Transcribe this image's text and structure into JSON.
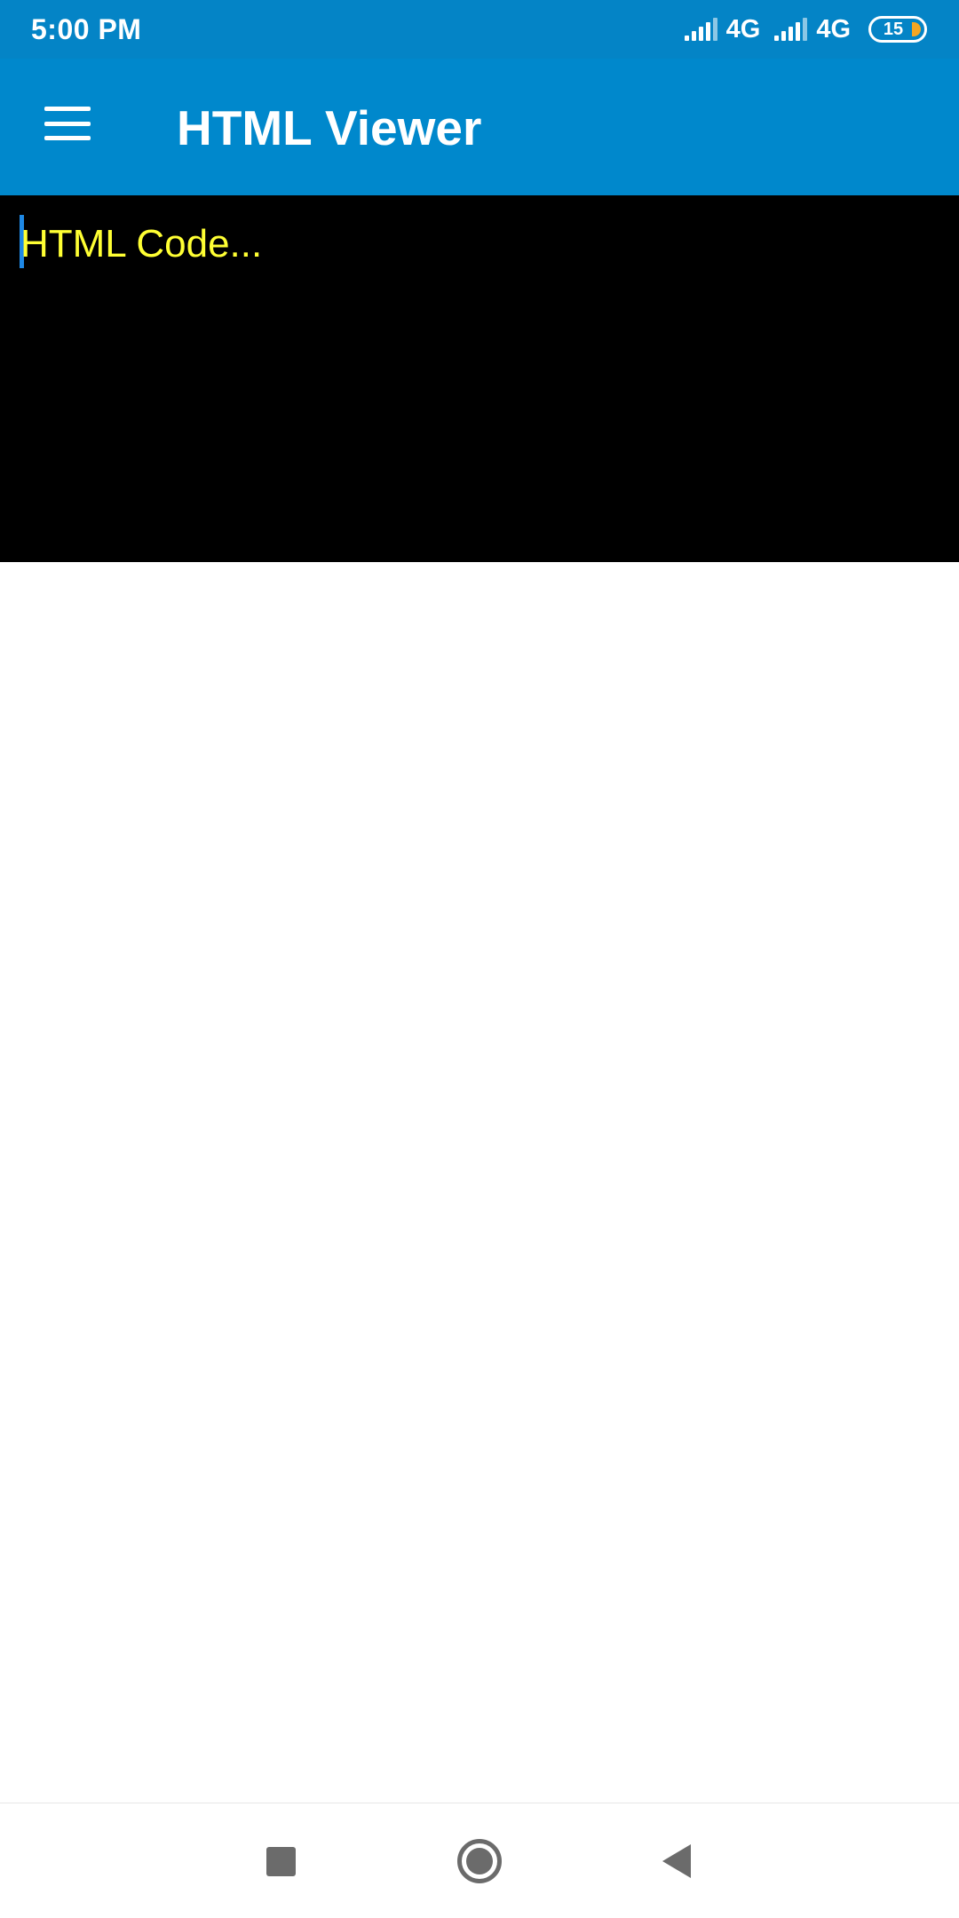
{
  "status_bar": {
    "time": "5:00 PM",
    "network_1": "4G",
    "network_2": "4G",
    "battery_level": "15",
    "icons": [
      "signal-icon",
      "signal-icon",
      "battery-icon"
    ]
  },
  "app_bar": {
    "title": "HTML Viewer",
    "menu_icon": "menu-icon"
  },
  "editor": {
    "placeholder": "HTML Code..."
  },
  "nav_bar": {
    "icons": [
      "recents-icon",
      "home-icon",
      "back-icon"
    ]
  },
  "colors": {
    "status_bar": "#0484c6",
    "app_bar": "#0088cc",
    "editor_background": "#000000",
    "placeholder_text": "#ffff33",
    "caret": "#1e88e5",
    "battery_accent": "#f5a623"
  }
}
